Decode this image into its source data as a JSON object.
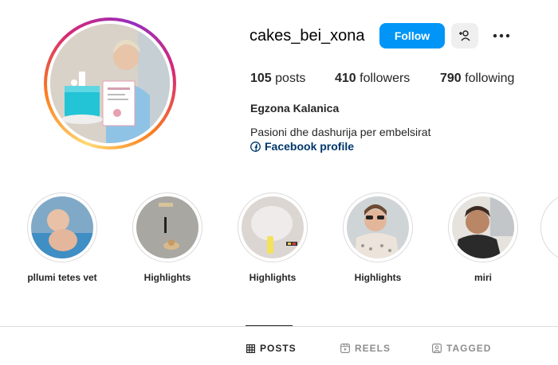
{
  "profile": {
    "username": "cakes_bei_xona",
    "follow_label": "Follow",
    "stats": {
      "posts_count": "105",
      "posts_label": "posts",
      "followers_count": "410",
      "followers_label": "followers",
      "following_count": "790",
      "following_label": "following"
    },
    "full_name": "Egzona Kalanica",
    "bio": "Pasioni dhe dashurija per embelsirat",
    "facebook_link": "Facebook profile"
  },
  "highlights": [
    {
      "label": "pllumi tetes vet"
    },
    {
      "label": "Highlights"
    },
    {
      "label": "Highlights"
    },
    {
      "label": "Highlights"
    },
    {
      "label": "miri"
    }
  ],
  "tabs": [
    {
      "label": "POSTS",
      "icon": "grid-icon"
    },
    {
      "label": "REELS",
      "icon": "reels-icon"
    },
    {
      "label": "TAGGED",
      "icon": "tagged-icon"
    }
  ],
  "colors": {
    "accent": "#0095f6",
    "link": "#00376b"
  }
}
